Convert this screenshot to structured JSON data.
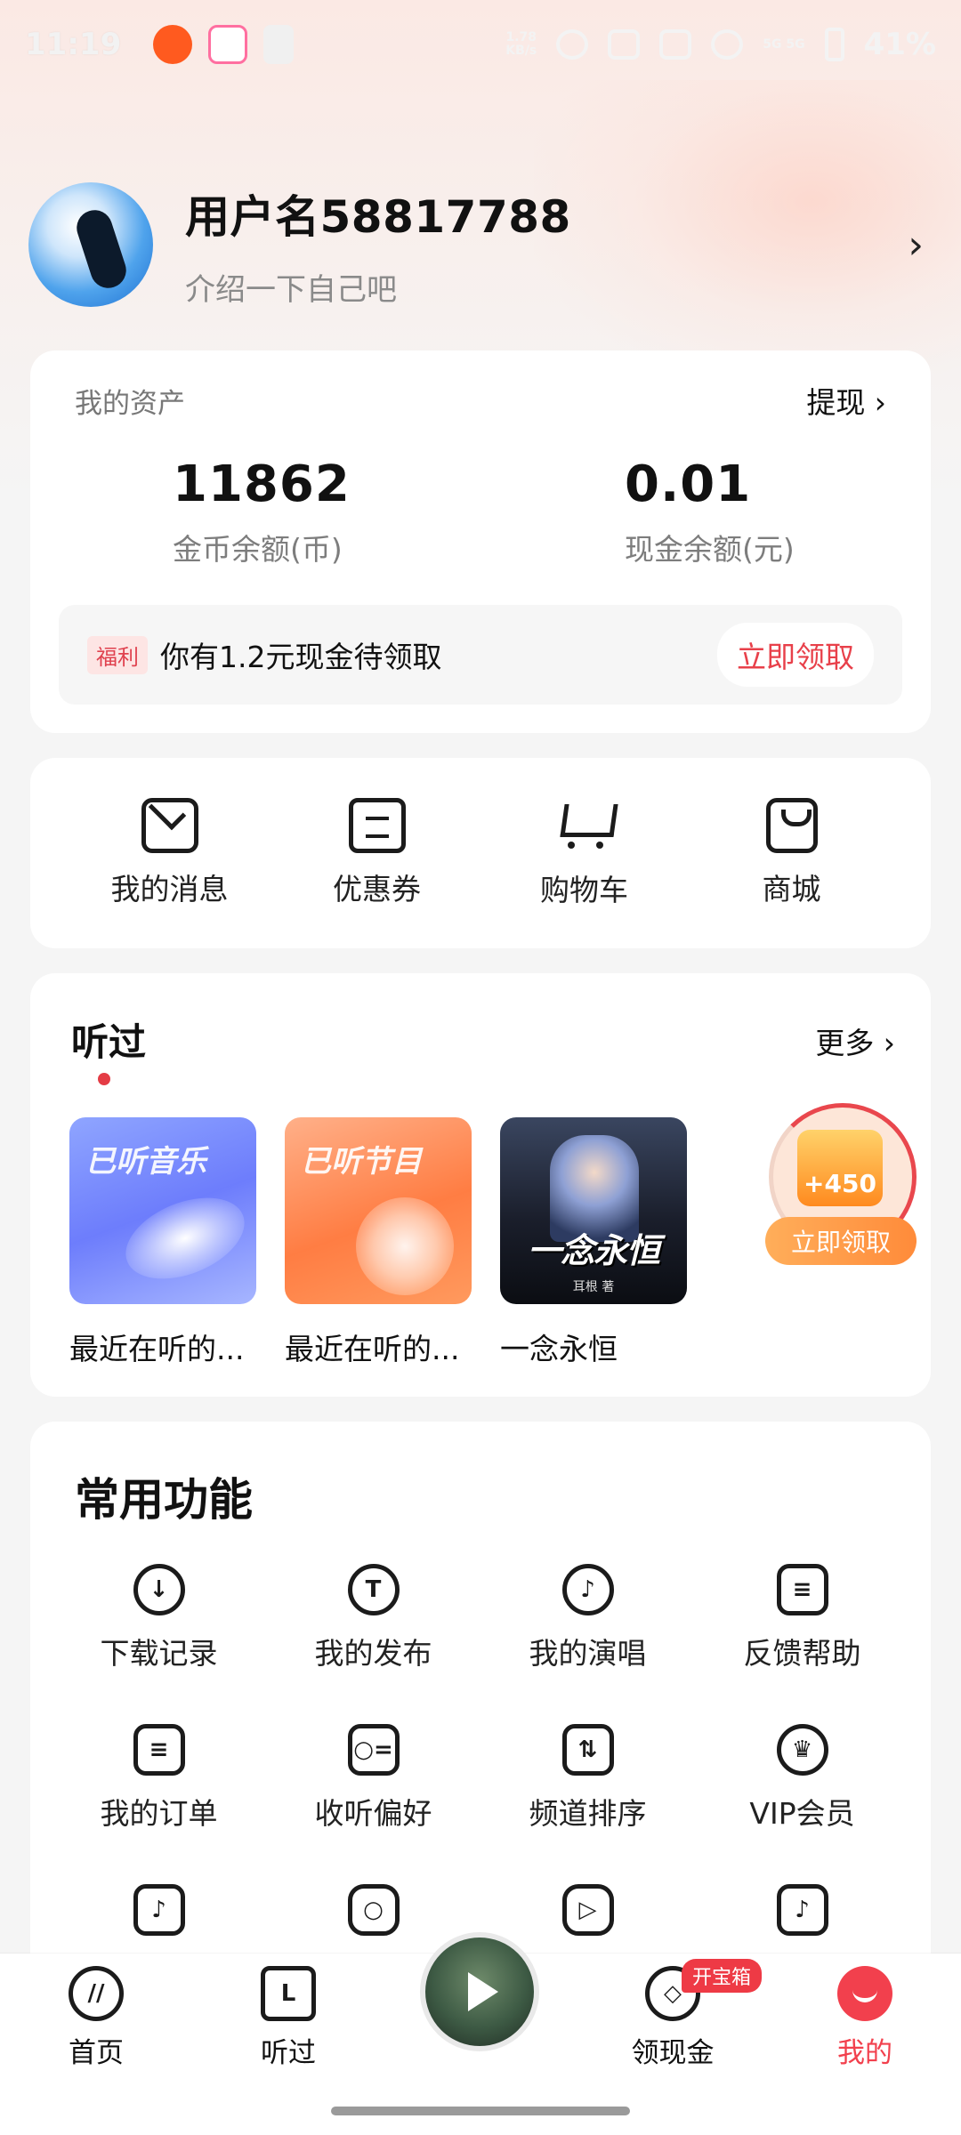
{
  "status_bar": {
    "time": "11:19",
    "network_speed": "1.78\nKB/s",
    "signal_label": "5G 5G",
    "battery": "41%"
  },
  "profile": {
    "username": "用户名58817788",
    "bio": "介绍一下自己吧",
    "arrow": "›"
  },
  "assets": {
    "title": "我的资产",
    "withdraw_label": "提现 ›",
    "coins_value": "11862",
    "coins_label": "金币余额(币)",
    "cash_value": "0.01",
    "cash_label": "现金余额(元)",
    "bonus_tag": "福利",
    "bonus_text": "你有1.2元现金待领取",
    "claim_label": "立即领取"
  },
  "shortcuts": [
    {
      "label": "我的消息",
      "icon": "mail-icon"
    },
    {
      "label": "优惠券",
      "icon": "coupon-icon"
    },
    {
      "label": "购物车",
      "icon": "cart-icon"
    },
    {
      "label": "商城",
      "icon": "shopping-bag-icon"
    }
  ],
  "history": {
    "title": "听过",
    "more_label": "更多 ›",
    "items": [
      {
        "cover_text": "已听音乐",
        "label": "最近在听的..."
      },
      {
        "cover_text": "已听节目",
        "label": "最近在听的..."
      },
      {
        "cover_text": "一念永恒",
        "cover_author": "耳根 著",
        "label": "一念永恒"
      }
    ],
    "reward": {
      "amount": "+450",
      "button": "立即领取"
    }
  },
  "functions": {
    "title": "常用功能",
    "items": [
      {
        "label": "下载记录",
        "icon": "download-icon",
        "glyph": "↓"
      },
      {
        "label": "我的发布",
        "icon": "publish-icon",
        "glyph": "T"
      },
      {
        "label": "我的演唱",
        "icon": "microphone-icon",
        "glyph": "♪"
      },
      {
        "label": "反馈帮助",
        "icon": "feedback-icon",
        "glyph": "≡"
      },
      {
        "label": "我的订单",
        "icon": "order-icon",
        "glyph": "≡"
      },
      {
        "label": "收听偏好",
        "icon": "preference-icon",
        "glyph": "○="
      },
      {
        "label": "频道排序",
        "icon": "sort-icon",
        "glyph": "⇅"
      },
      {
        "label": "VIP会员",
        "icon": "crown-icon",
        "glyph": "♛"
      },
      {
        "label": "",
        "icon": "music-folder-icon",
        "glyph": "♪"
      },
      {
        "label": "",
        "icon": "hexagon-icon",
        "glyph": "○"
      },
      {
        "label": "",
        "icon": "play-shield-icon",
        "glyph": "▷"
      },
      {
        "label": "",
        "icon": "music-box-icon",
        "glyph": "♪"
      }
    ]
  },
  "bottom_nav": {
    "home": "首页",
    "history": "听过",
    "rewards": "领现金",
    "rewards_badge": "开宝箱",
    "mine": "我的"
  },
  "colors": {
    "accent_red": "#e8404a",
    "reward_orange": "#ff8b3a"
  }
}
